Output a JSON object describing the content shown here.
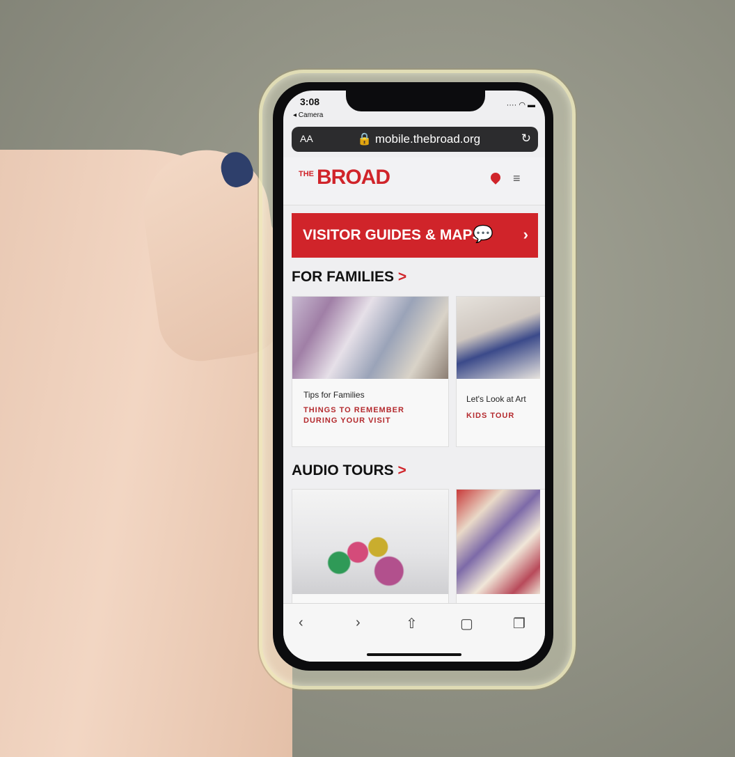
{
  "status": {
    "time": "3:08",
    "back_app": "◂ Camera"
  },
  "browser": {
    "text_size": "AA",
    "url": "🔒 mobile.thebroad.org",
    "reload_icon": "reload-icon"
  },
  "site": {
    "logo_prefix": "THE",
    "logo_main": "BROAD",
    "accent_color": "#d0242a"
  },
  "banner": {
    "label": "VISITOR GUIDES & MAPS",
    "arrow": "›",
    "icon": "translate-icon"
  },
  "families": {
    "title": "FOR FAMILIES",
    "chevron": ">",
    "cards": [
      {
        "title": "Tips for Families",
        "link": "THINGS TO REMEMBER DURING YOUR VISIT"
      },
      {
        "title": "Let's Look at Art",
        "link": "KIDS TOUR"
      }
    ]
  },
  "audio": {
    "title": "AUDIO TOURS",
    "chevron": ">"
  },
  "toolbar": {
    "back": "‹",
    "forward": "›"
  }
}
